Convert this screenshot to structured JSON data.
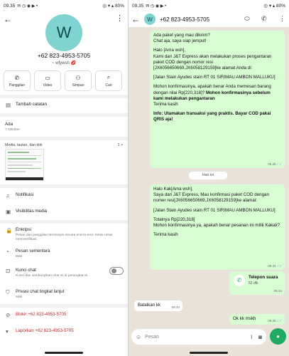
{
  "status_left": {
    "time": "09.35",
    "icons": "✉ ◷ ◉ ▶ •",
    "right": "◎ ▾ ▴ 80%"
  },
  "status_right": {
    "time": "09.35",
    "icons": "✉ ◷ ◉ ▶ •",
    "right": "◎ ▾ ▴ 80%"
  },
  "contact": {
    "avatar_letter": "W",
    "phone": "+62 823-4953-5705",
    "nickname": "~ wfywsh"
  },
  "actions": [
    {
      "label": "Panggilan",
      "icon": "phone-icon"
    },
    {
      "label": "Video",
      "icon": "video-icon"
    },
    {
      "label": "Simpan",
      "icon": "add-person-icon"
    },
    {
      "label": "Cari",
      "icon": "search-icon"
    }
  ],
  "note_label": "Tambah catatan",
  "about": {
    "title": "Ada",
    "date": "7 Oktober"
  },
  "media": {
    "label": "Media, tautan, dan dok",
    "count": "1 >"
  },
  "settings": {
    "notifications": "Notifikasi",
    "media_visibility": "Visibilitas media",
    "encryption_title": "Enkripsi",
    "encryption_sub": "Pesan dan panggilan terenkripsi secara end-to-end. Ketuk untuk memverifikasi.",
    "disappearing_title": "Pesan sementara",
    "disappearing_sub": "Mati",
    "lock_title": "Kunci chat",
    "lock_sub": "Kunci dan sembunyikan chat ini di perangkat ini.",
    "privacy_title": "Privasi chat tingkat lanjut",
    "privacy_sub": "Mati",
    "block": "Blokir +62 823-4953-5705",
    "report": "Laporkan +62 823-4953-5705"
  },
  "chat": {
    "header_phone": "+62 823-4953-5705",
    "date_chip": "Hari ini",
    "m1": {
      "p1": "Ada paket yang mau dikirim?\nChat aja, saya siap jemput!",
      "p2": "Halo [Ama wsh],\nKami dari J&T Express akan melakukan proses pengantaran paket COD dengan nomor resi [JX6056650669,JX6058129159]ke alamat Anda di:",
      "p3": "[Jalan Stain Ayudes  stain RT 01 SIRIMAU AMBON MALLUKU]",
      "p4a": "Mohon konfirmasinya, apakah benar Anda memesan barang dengan nilai Rp[220,318]? ",
      "p4b": "Mohon konfirmasinya sebelum kami melakukan pengantaran",
      "p4c": "Terima kasih",
      "p5": "Info: Utamakan transaksi yang praktis. Bayar COD pakai QRIS aja!",
      "time": "05.25"
    },
    "m2": {
      "time": "05.26"
    },
    "m3": {
      "p1": "Halo Kak[Ama wsh],\nSaya dari J&T Express, Mau konfirmasi paket COD dengan nomer resi[JX6056650669,JX6058129159]ke alamat:",
      "p2": "[Jalan Stain Ayudes  stain RT 01 SIRIMAU AMBON MALLUKU]",
      "p3": "Totalnya Rp[220,318]\nMohon konfirmasinya ya, apakah benar pesanan ini milik Kakak?",
      "p4": "Terima kasih",
      "time": "09.34"
    },
    "call": {
      "title": "Telepon suara",
      "duration": "52 dtk",
      "time": "09.34"
    },
    "m4": {
      "text": "Batalkan kk",
      "time": "09.34"
    },
    "m5": {
      "text": "Ok kk mskh",
      "time": "09.35"
    },
    "placeholder": "Pesan"
  }
}
